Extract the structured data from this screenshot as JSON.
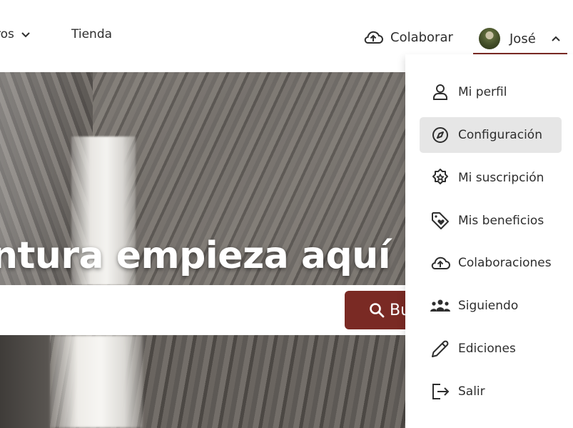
{
  "nav": {
    "prev_label": "ros",
    "store_label": "Tienda",
    "collaborate_label": "Colaborar",
    "user_name": "José"
  },
  "hero": {
    "title": "ntura empieza aquí"
  },
  "search": {
    "button_label": "Bu"
  },
  "user_menu": {
    "items": [
      {
        "label": "Mi perfil",
        "icon": "user-icon"
      },
      {
        "label": "Configuración",
        "icon": "compass-icon"
      },
      {
        "label": "Mi suscripción",
        "icon": "star-badge-icon"
      },
      {
        "label": "Mis beneficios",
        "icon": "tag-heart-icon"
      },
      {
        "label": "Colaboraciones",
        "icon": "cloud-upload-icon"
      },
      {
        "label": "Siguiendo",
        "icon": "group-icon"
      },
      {
        "label": "Ediciones",
        "icon": "pencil-icon"
      },
      {
        "label": "Salir",
        "icon": "logout-icon"
      }
    ],
    "active_item": "Configuración"
  },
  "colors": {
    "accent": "#7a2a24",
    "active_bg": "#e6e6e6",
    "text": "#2e2e2e"
  }
}
